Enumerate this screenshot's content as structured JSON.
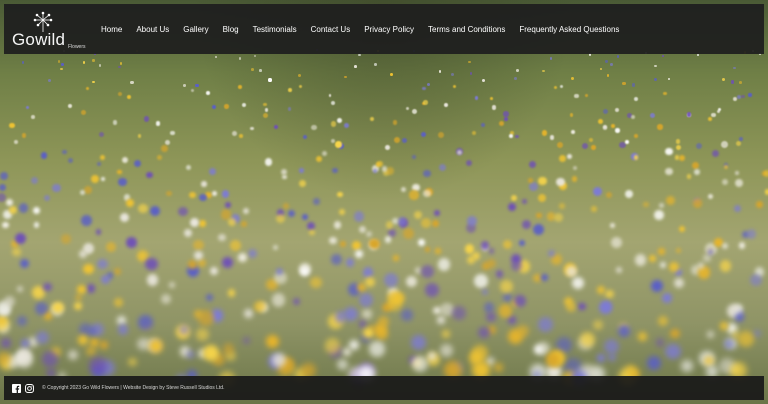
{
  "brand": {
    "name": "Gowild",
    "tagline": "Flowers"
  },
  "nav": {
    "items": [
      "Home",
      "About Us",
      "Gallery",
      "Blog",
      "Testimonials",
      "Contact Us",
      "Privacy Policy",
      "Terms and Conditions",
      "Frequently Asked Questions"
    ]
  },
  "footer": {
    "copyright": "© Copyright 2023 Go Wild Flowers | Website Design by Steve Russell Studios Ltd.",
    "social": [
      "facebook-icon",
      "instagram-icon"
    ]
  },
  "colors": {
    "header_bg": "#1e1e1e",
    "footer_bg": "#191919",
    "text": "#ffffff"
  }
}
